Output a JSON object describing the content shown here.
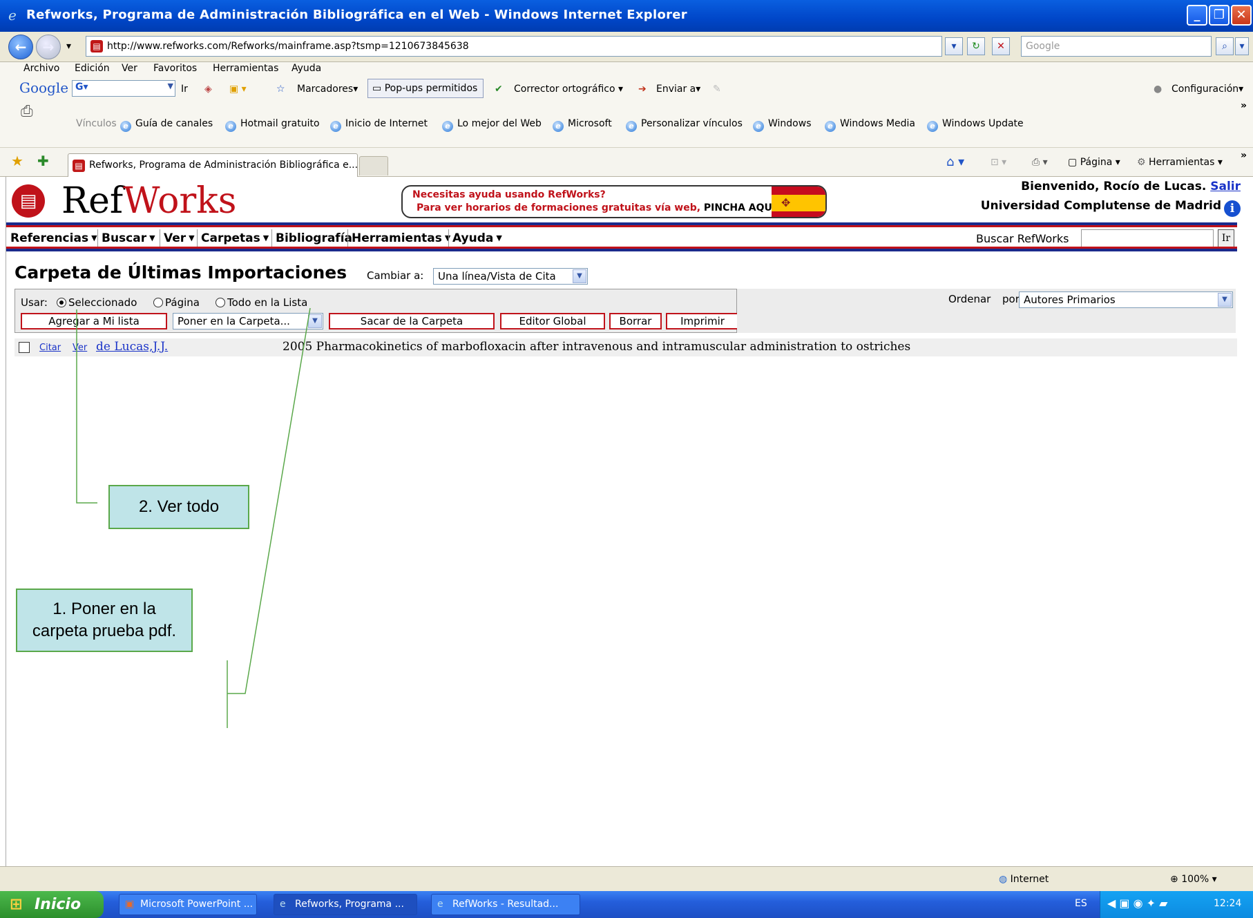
{
  "window": {
    "title": "Refworks, Programa de Administración Bibliográfica en el Web - Windows Internet Explorer"
  },
  "address": {
    "url": "http://www.refworks.com/Refworks/mainframe.asp?tsmp=1210673845638",
    "search_placeholder": "Google"
  },
  "menu": [
    "Archivo",
    "Edición",
    "Ver",
    "Favoritos",
    "Herramientas",
    "Ayuda"
  ],
  "google_toolbar": {
    "logo": "Google",
    "go": "Ir",
    "bookmarks": "Marcadores",
    "popups": "Pop-ups permitidos",
    "spell": "Corrector ortográfico",
    "send": "Enviar a",
    "settings": "Configuración"
  },
  "links_bar": {
    "label": "Vínculos",
    "items": [
      "Guía de canales",
      "Hotmail gratuito",
      "Inicio de Internet",
      "Lo mejor del Web",
      "Microsoft",
      "Personalizar vínculos",
      "Windows",
      "Windows Media",
      "Windows Update"
    ]
  },
  "tab": {
    "title": "Refworks, Programa de Administración Bibliográfica e..."
  },
  "commandbar": {
    "page": "Página",
    "tools": "Herramientas"
  },
  "refworks": {
    "logo_ref": "Ref",
    "logo_works": "Works",
    "banner_line1": "Necesitas ayuda usando RefWorks?",
    "banner_line2": "Para ver horarios de formaciones gratuitas vía web,",
    "banner_line2_bold": "PINCHA AQUÍ.",
    "welcome": "Bienvenido, Rocío de Lucas.",
    "logout": "Salir",
    "university": "Universidad Complutense de Madrid",
    "nav": [
      "Referencias",
      "Buscar",
      "Ver",
      "Carpetas",
      "Bibliografía",
      "Herramientas",
      "Ayuda"
    ],
    "search_label": "Buscar RefWorks",
    "search_go": "Ir",
    "heading": "Carpeta de Últimas Importaciones",
    "change_to": "Cambiar a:",
    "view_option": "Una línea/Vista de Cita",
    "use_label": "Usar:",
    "use_options": [
      "Seleccionado",
      "Página",
      "Todo en la Lista"
    ],
    "buttons": {
      "add_list": "Agregar a Mi lista",
      "put_folder": "Poner en la Carpeta...",
      "remove_folder": "Sacar de la Carpeta",
      "global_editor": "Editor Global",
      "delete": "Borrar",
      "print": "Imprimir"
    },
    "sort_label": "Ordenar",
    "sort_by": "por",
    "sort_value": "Autores Primarios",
    "record": {
      "cite": "Citar",
      "view": "Ver",
      "author": "de Lucas,J.J.",
      "text": "2005 Pharmacokinetics of marbofloxacin after intravenous and intramuscular administration to ostriches"
    }
  },
  "callouts": {
    "one_line1": "1. Poner en la",
    "one_line2": "carpeta prueba pdf.",
    "two": "2. Ver todo"
  },
  "status": {
    "zone": "Internet",
    "zoom": "100%"
  },
  "taskbar": {
    "start": "Inicio",
    "tasks": [
      "Microsoft PowerPoint ...",
      "Refworks, Programa ...",
      "RefWorks - Resultad..."
    ],
    "lang": "ES",
    "clock": "12:24"
  }
}
